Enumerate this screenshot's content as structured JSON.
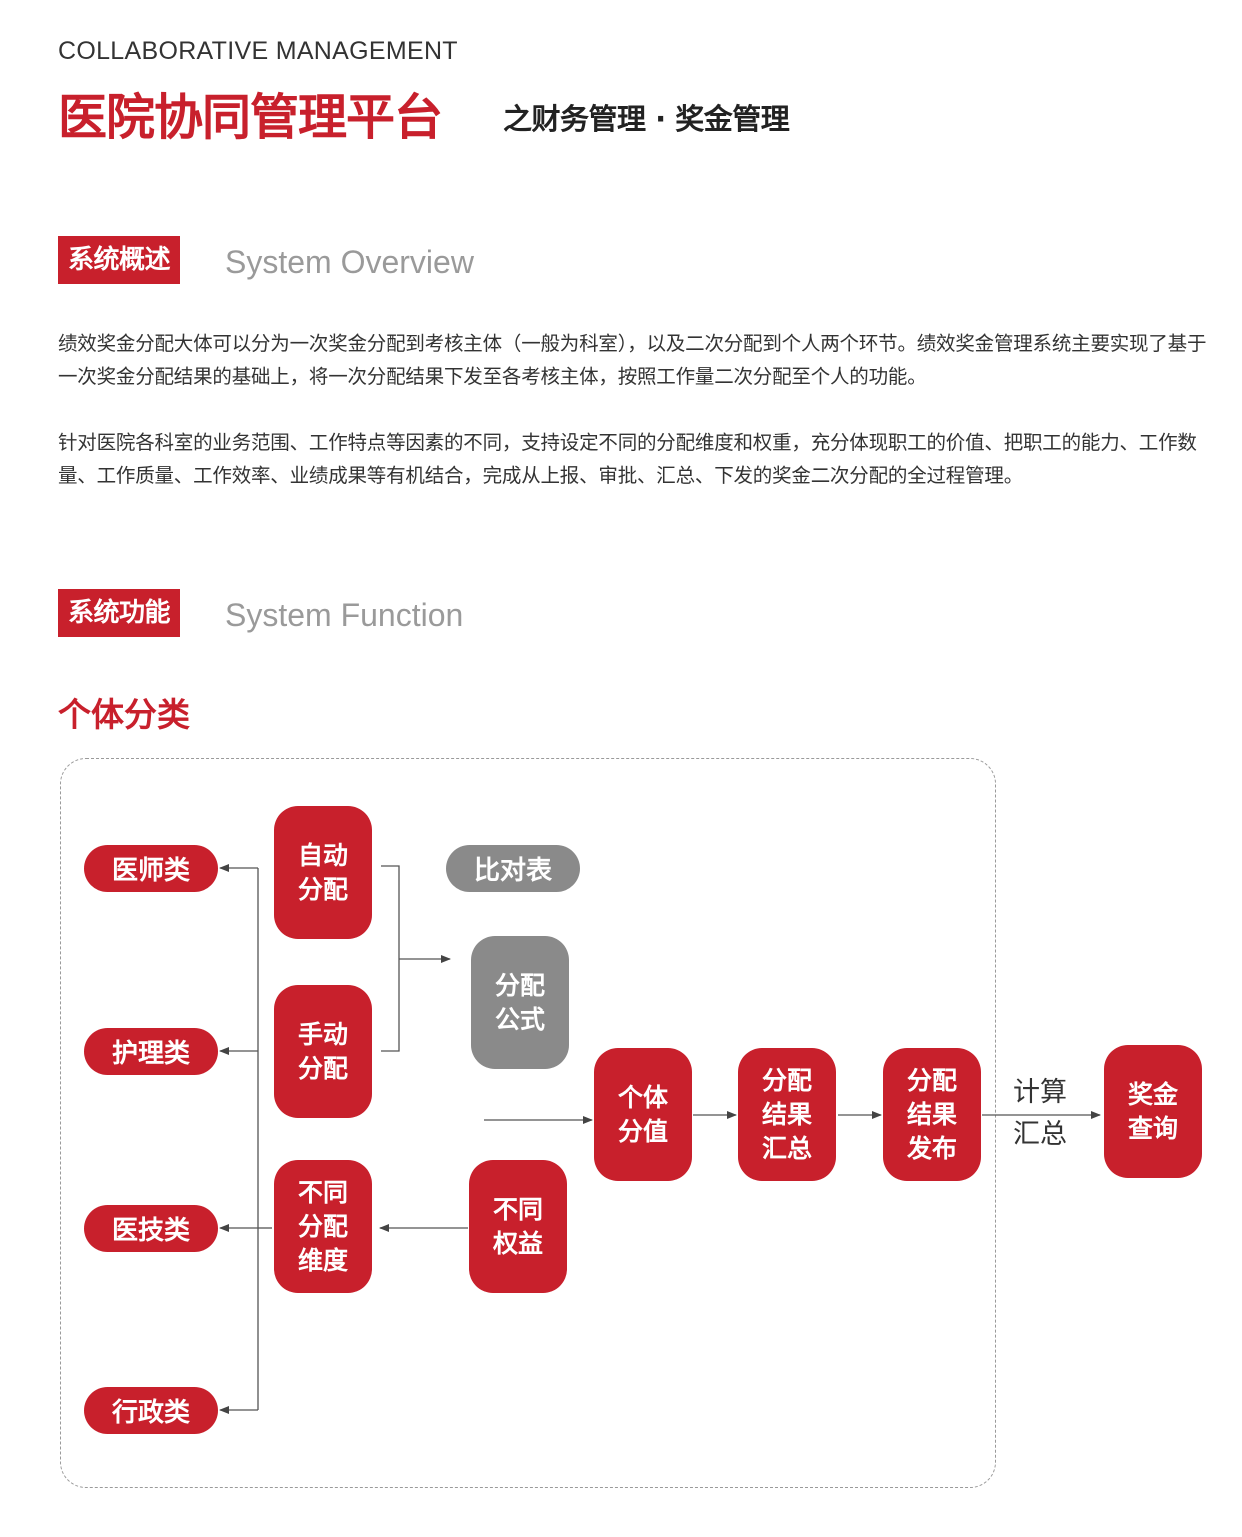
{
  "header": {
    "eyebrow": "COLLABORATIVE MANAGEMENT",
    "title": "医院协同管理平台",
    "subtitle": "之财务管理 · 奖金管理"
  },
  "overview": {
    "tag": "系统概述",
    "title_en": "System Overview",
    "paragraphs": [
      "绩效奖金分配大体可以分为一次奖金分配到考核主体（一般为科室），以及二次分配到个人两个环节。绩效奖金管理系统主要实现了基于一次奖金分配结果的基础上，将一次分配结果下发至各考核主体，按照工作量二次分配至个人的功能。",
      "针对医院各科室的业务范围、工作特点等因素的不同，支持设定不同的分配维度和权重，充分体现职工的价值、把职工的能力、工作数量、工作质量、工作效率、业绩成果等有机结合，完成从上报、审批、汇总、下发的奖金二次分配的全过程管理。"
    ]
  },
  "function": {
    "tag": "系统功能",
    "title_en": "System Function",
    "subsection": "个体分类"
  },
  "diagram": {
    "categories": [
      "医师类",
      "护理类",
      "医技类",
      "行政类"
    ],
    "auto_alloc": "自动\n分配",
    "manual_alloc": "手动\n分配",
    "diff_dimension": "不同\n分配\n维度",
    "compare_table": "比对表",
    "formula": "分配\n公式",
    "diff_interest": "不同\n权益",
    "individual_value": "个体\n分值",
    "result_summary": "分配\n结果\n汇总",
    "result_publish": "分配\n结果\n发布",
    "calc_summary": "计算\n汇总",
    "bonus_query": "奖金\n查询",
    "colors": {
      "red": "#c8202c",
      "grey": "#8a8a8a"
    }
  }
}
